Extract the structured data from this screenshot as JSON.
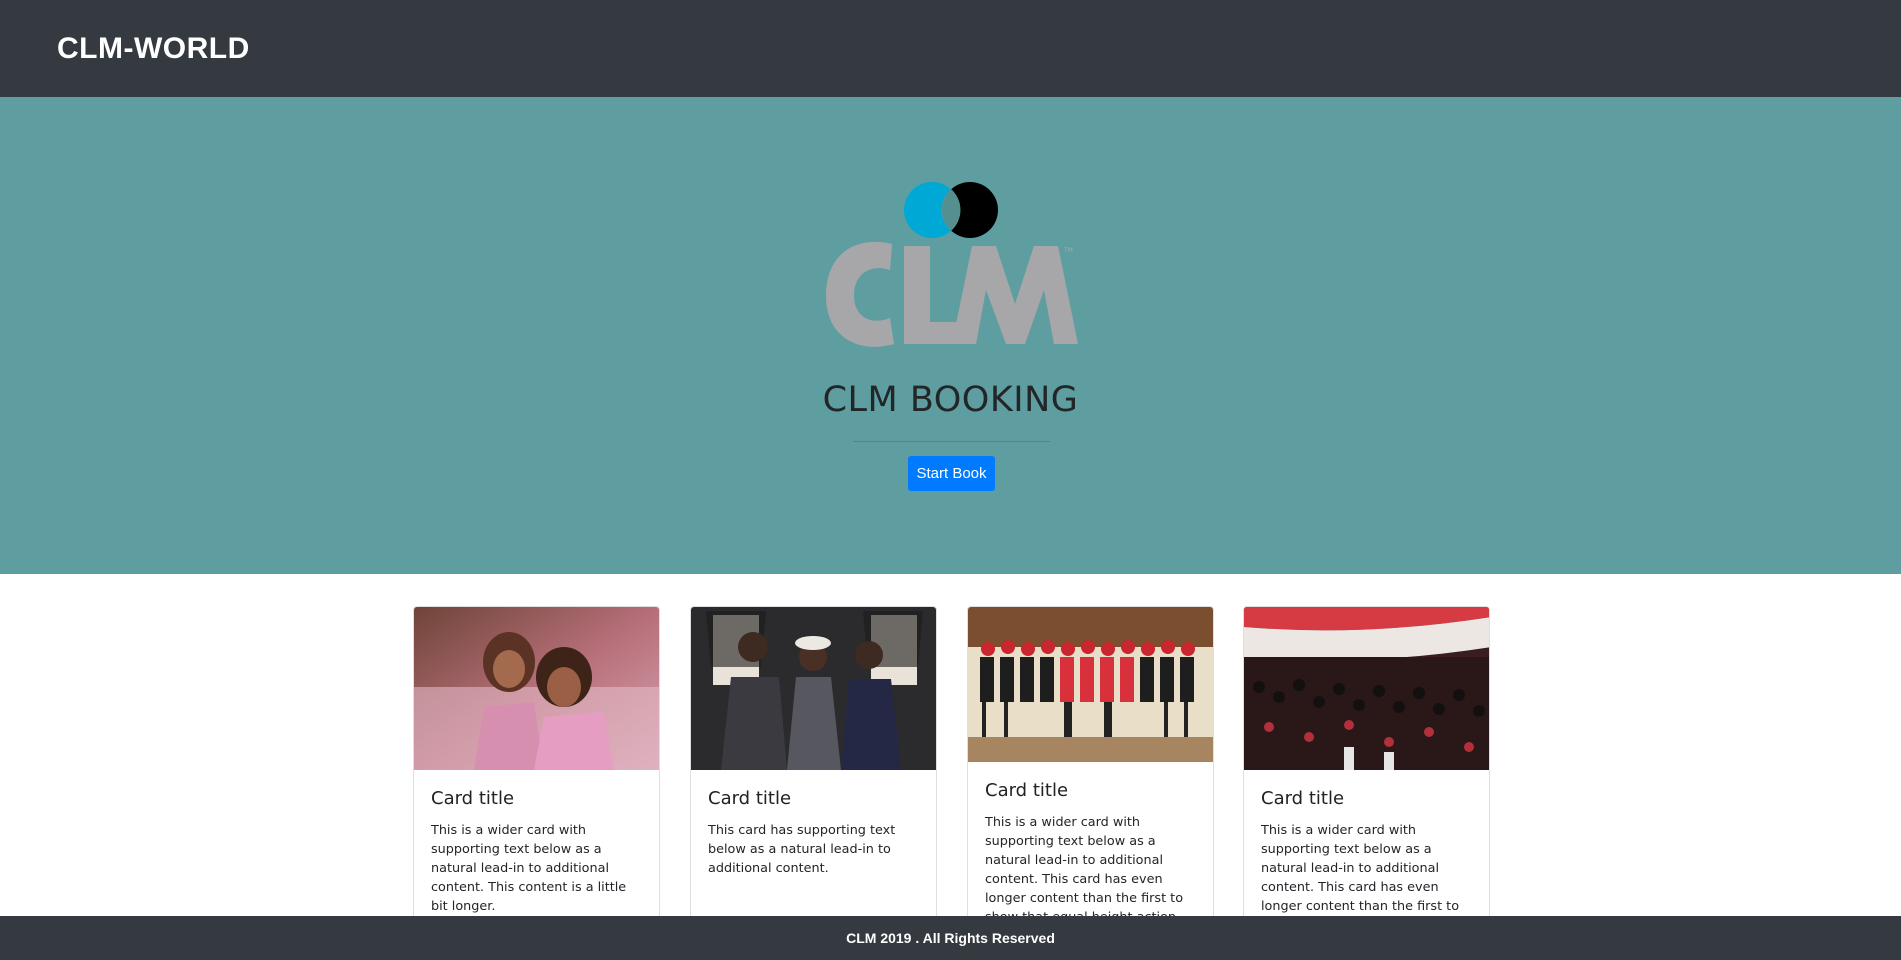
{
  "navbar": {
    "brand": "CLM-WORLD"
  },
  "hero": {
    "logo_text": "CLM",
    "title": "CLM BOOKING",
    "button_label": "Start Book"
  },
  "cards": [
    {
      "title": "Card title",
      "text": "This is a wider card with supporting text below as a natural lead-in to additional content. This content is a little bit longer."
    },
    {
      "title": "Card title",
      "text": "This card has supporting text below as a natural lead-in to additional content."
    },
    {
      "title": "Card title",
      "text": "This is a wider card with supporting text below as a natural lead-in to additional content. This card has even longer content than the first to show that equal height action."
    },
    {
      "title": "Card title",
      "text": "This is a wider card with supporting text below as a natural lead-in to additional content. This card has even longer content than the first to"
    }
  ],
  "footer": {
    "text": "CLM 2019 . All Rights Reserved"
  },
  "colors": {
    "navbar": "#343a40",
    "hero": "#5f9ea0",
    "button": "#007bff",
    "logo_gray": "#a7a7aa",
    "logo_blue": "#00a8d6"
  }
}
